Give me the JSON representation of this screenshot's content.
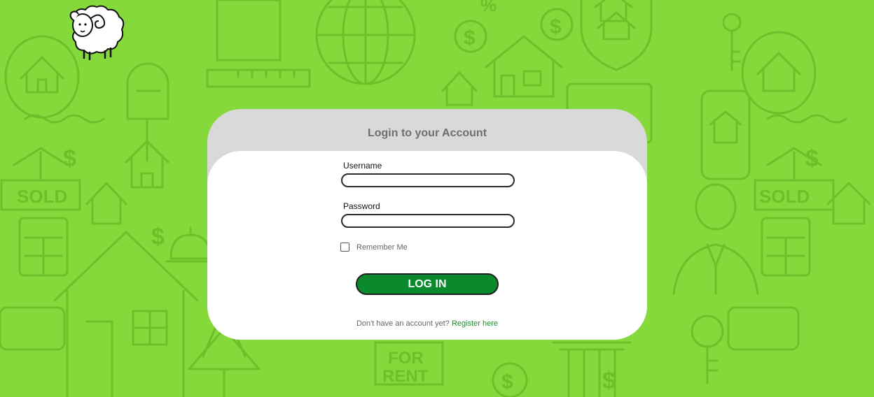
{
  "login_card": {
    "title": "Login to your Account",
    "username_label": "Username",
    "username_value": "",
    "password_label": "Password",
    "password_value": "",
    "remember_me_label": "Remember Me",
    "remember_me_checked": false,
    "login_button_label": "LOG IN",
    "register_prompt": "Don't have an account yet?",
    "register_link_label": "Register here"
  },
  "background": {
    "sold_sign_text": "SOLD",
    "for_rent_sign_text": "FOR RENT",
    "currency_symbol": "$",
    "percent_symbol": "%"
  },
  "colors": {
    "background_green": "#86d93b",
    "pattern_line": "#6cc02a",
    "card_header": "#d9d9d9",
    "button_green": "#0a8a2c",
    "link_green": "#1e8a2e"
  }
}
